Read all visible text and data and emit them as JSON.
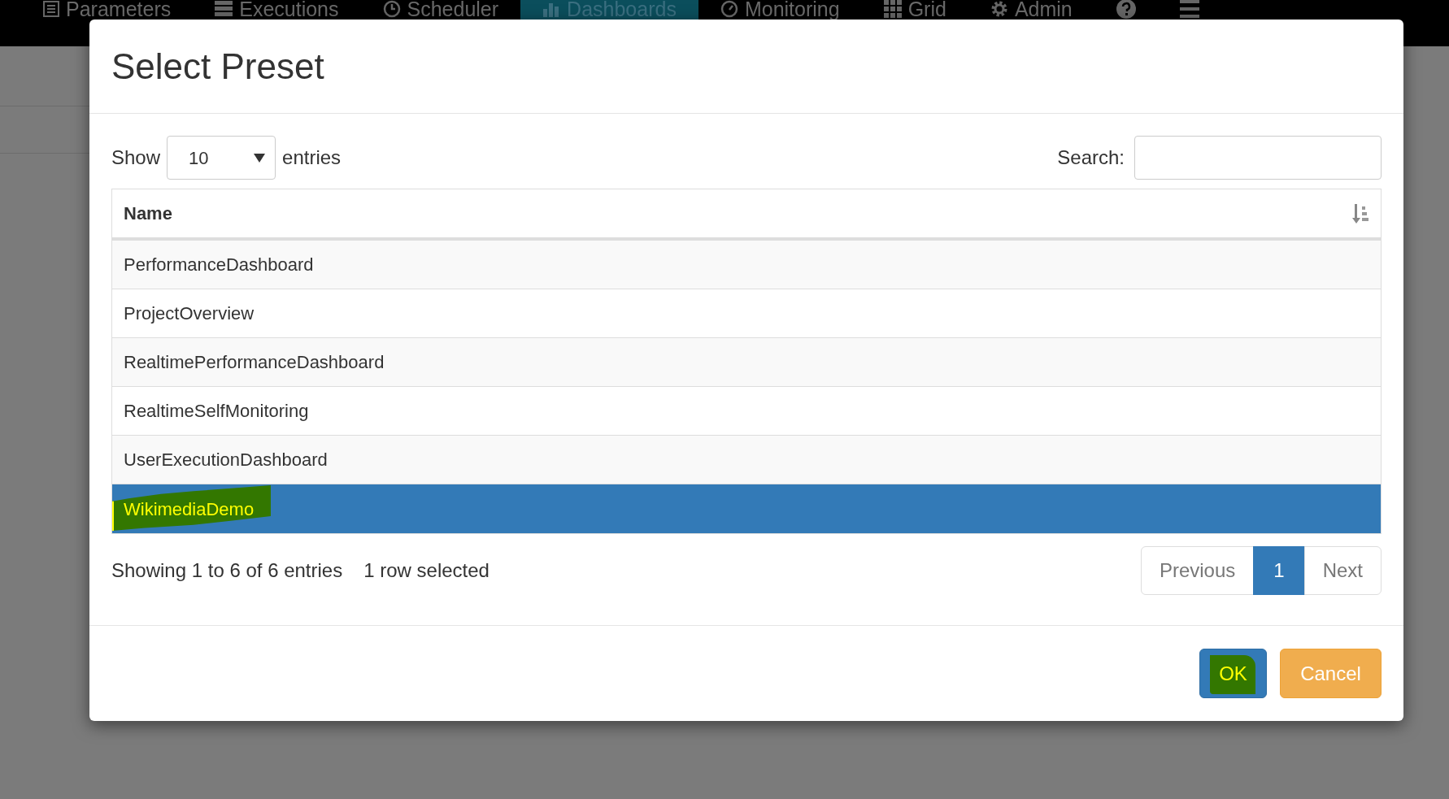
{
  "navbar": {
    "items": [
      {
        "label": "Parameters",
        "kind": "list",
        "selected": false
      },
      {
        "label": "Executions",
        "kind": "stack",
        "selected": false
      },
      {
        "label": "Scheduler",
        "kind": "clock",
        "selected": false
      },
      {
        "label": "Dashboards",
        "kind": "bars",
        "selected": true
      },
      {
        "label": "Monitoring",
        "kind": "gauge",
        "selected": false
      },
      {
        "label": "Grid",
        "kind": "grid",
        "selected": false
      },
      {
        "label": "Admin",
        "kind": "gear",
        "selected": false
      },
      {
        "kind": "help",
        "selected": false
      },
      {
        "kind": "menu",
        "selected": false
      }
    ]
  },
  "modal": {
    "title": "Select Preset",
    "length_menu": {
      "before": "Show",
      "value": "10",
      "after": "entries"
    },
    "search": {
      "label": "Search:"
    },
    "table": {
      "columns": [
        {
          "label": "Name",
          "sorted": true
        }
      ],
      "rows": [
        {
          "name": "PerformanceDashboard",
          "selected": false,
          "highlighted": false
        },
        {
          "name": "ProjectOverview",
          "selected": false,
          "highlighted": false
        },
        {
          "name": "RealtimePerformanceDashboard",
          "selected": false,
          "highlighted": false
        },
        {
          "name": "RealtimeSelfMonitoring",
          "selected": false,
          "highlighted": false
        },
        {
          "name": "UserExecutionDashboard",
          "selected": false,
          "highlighted": false
        },
        {
          "name": "WikimediaDemo",
          "selected": true,
          "highlighted": true
        }
      ]
    },
    "info": "Showing 1 to 6 of 6 entries",
    "selection_info": "1 row selected",
    "pagination": [
      {
        "label": "Previous",
        "kind": "prev",
        "selected": false
      },
      {
        "label": "1",
        "kind": "page",
        "selected": true
      },
      {
        "label": "Next",
        "kind": "next",
        "selected": false
      }
    ],
    "buttons": [
      {
        "label": "OK",
        "kind": "primary",
        "highlighted": true
      },
      {
        "label": "Cancel",
        "kind": "warning",
        "highlighted": false
      }
    ]
  }
}
